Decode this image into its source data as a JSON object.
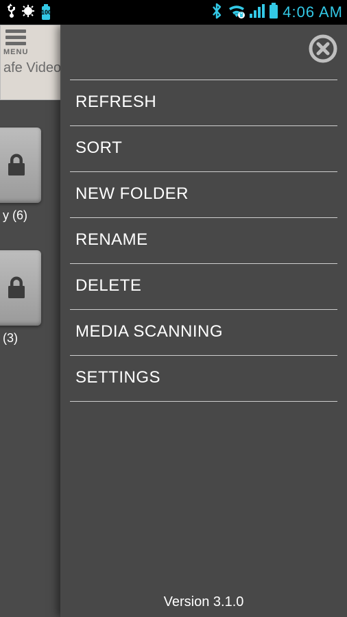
{
  "status_bar": {
    "battery_pct": "100",
    "clock": "4:06 AM"
  },
  "background": {
    "menu_label": "MENU",
    "title_fragment": "afe Video",
    "items": [
      {
        "count": "y (6)"
      },
      {
        "count": "(3)"
      }
    ]
  },
  "menu": {
    "items": [
      {
        "label": "REFRESH"
      },
      {
        "label": "SORT"
      },
      {
        "label": "NEW FOLDER"
      },
      {
        "label": "RENAME"
      },
      {
        "label": "DELETE"
      },
      {
        "label": "MEDIA SCANNING"
      },
      {
        "label": "SETTINGS"
      }
    ]
  },
  "version": "Version 3.1.0"
}
